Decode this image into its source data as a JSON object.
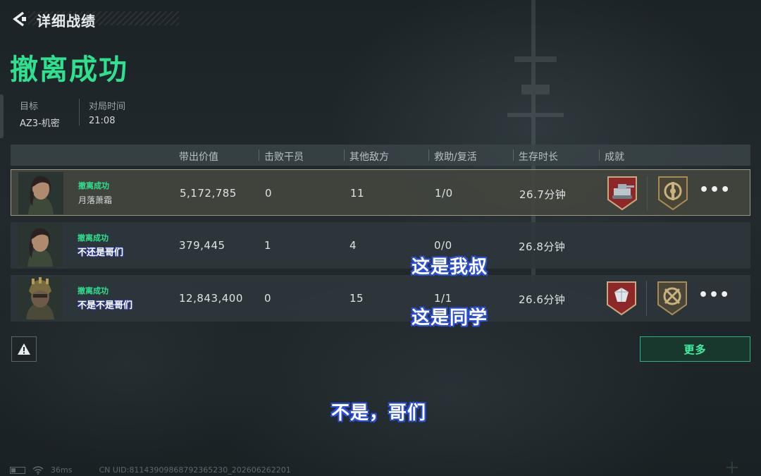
{
  "header": {
    "title": "详细战绩"
  },
  "result": {
    "title": "撤离成功"
  },
  "meta": {
    "target_label": "目标",
    "target_value": "AZ3-机密",
    "time_label": "对局时间",
    "time_value": "21:08"
  },
  "table": {
    "headers": [
      "带出价值",
      "击败干员",
      "其他敌方",
      "救助/复活",
      "生存时长",
      "成就"
    ],
    "rows": [
      {
        "status": "撤离成功",
        "name": "月落萧霜",
        "value": "5,172,785",
        "kills": "0",
        "others": "11",
        "assist": "1/0",
        "survival": "26.7分钟",
        "badges": [
          "tank-badge",
          "wheel-badge"
        ],
        "more": true
      },
      {
        "status": "撤离成功",
        "name": "不还是哥们",
        "value": "379,445",
        "kills": "1",
        "others": "4",
        "assist": "0/0",
        "survival": "26.8分钟",
        "badges": [],
        "more": false
      },
      {
        "status": "撤离成功",
        "name": "不是不是哥们",
        "value": "12,843,400",
        "kills": "0",
        "others": "15",
        "assist": "1/1",
        "survival": "26.6分钟",
        "badges": [
          "diamond-badge",
          "crosshair-badge"
        ],
        "more": true
      }
    ]
  },
  "buttons": {
    "more": "更多"
  },
  "captions": {
    "c1": "这是我叔",
    "c2": "这是同学",
    "c3": "不是，哥们"
  },
  "footer": {
    "ping": "36ms",
    "uid": "CN UID:8114390986879236523​0_202606262201"
  },
  "colors": {
    "accent": "#2fe08f",
    "badge_red": "#8e2727",
    "badge_gold": "#a58b55"
  }
}
